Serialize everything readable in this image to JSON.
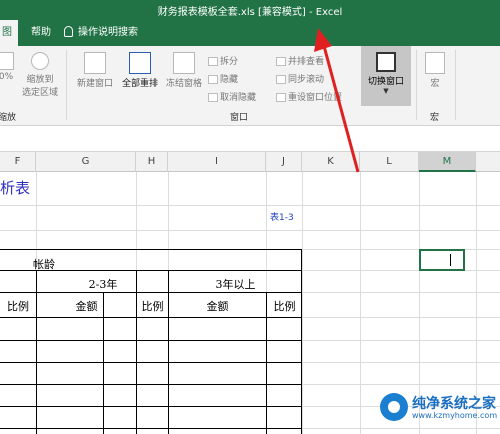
{
  "window": {
    "title": "财务报表模板全套.xls  [兼容模式]  -  Excel"
  },
  "menu": {
    "tab_view": "图",
    "tab_help": "帮助",
    "tell_me": "操作说明搜索"
  },
  "ribbon": {
    "zoom_pct": "0%",
    "zoom_selection_line1": "缩放到",
    "zoom_selection_line2": "选定区域",
    "new_window": "新建窗口",
    "arrange_all": "全部重排",
    "freeze_panes": "冻结窗格",
    "split": "拆分",
    "hide": "隐藏",
    "unhide": "取消隐藏",
    "view_side_by_side": "并排查看",
    "sync_scroll": "同步滚动",
    "reset_position": "重设窗口位置",
    "switch_windows": "切换窗口",
    "macros": "宏",
    "group_zoom": "缩放",
    "group_window": "窗口",
    "group_macros": "宏"
  },
  "columns": [
    "F",
    "G",
    "H",
    "I",
    "J",
    "K",
    "L",
    "M"
  ],
  "sheet": {
    "title_fragment": "析表",
    "table_no": "表1-3",
    "aging": "帐龄",
    "range_2_3": "2-3年",
    "range_3_plus": "3年以上",
    "ratio": "比例",
    "amount": "金额"
  },
  "watermark": {
    "name": "纯净系统之家",
    "url": "www.kzmyhome.com"
  },
  "colors": {
    "excel_green": "#217346",
    "title_blue": "#3030c0",
    "arrow_red": "#e02020"
  }
}
